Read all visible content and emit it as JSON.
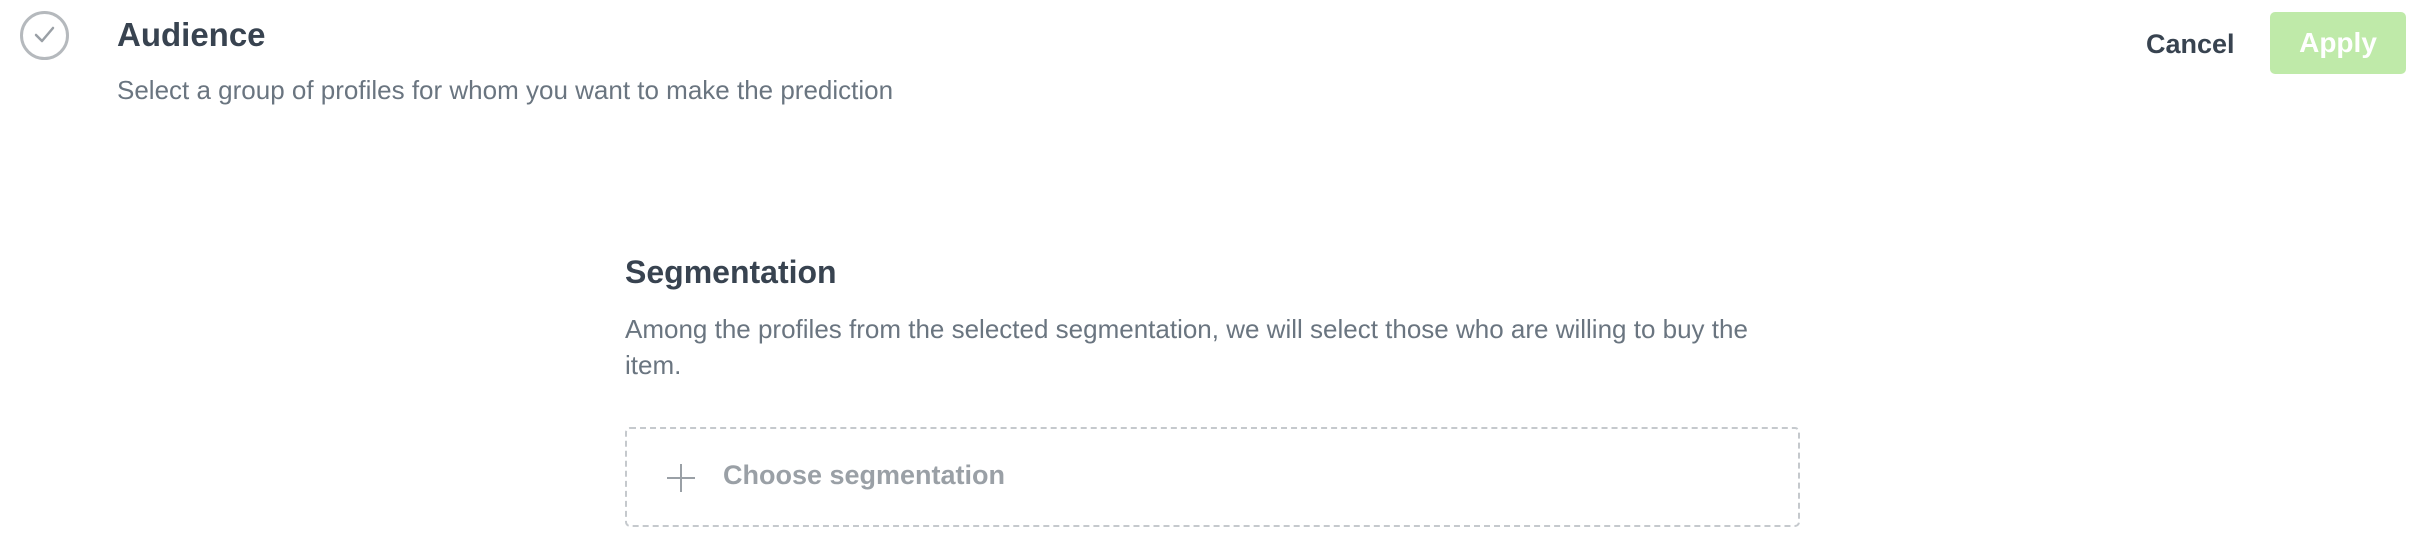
{
  "header": {
    "step_icon": "check-circle-icon",
    "title": "Audience",
    "subtitle": "Select a group of profiles for whom you want to make the prediction",
    "cancel_label": "Cancel",
    "apply_label": "Apply"
  },
  "segmentation": {
    "title": "Segmentation",
    "description": "Among the profiles from the selected segmentation, we will select those who are willing to buy the item.",
    "choose_label": "Choose segmentation",
    "choose_icon": "plus-icon"
  },
  "colors": {
    "apply_disabled_bg": "#bfeaa9",
    "text_primary": "#384350",
    "text_secondary": "#6a7580",
    "placeholder": "#9aa0a6"
  }
}
